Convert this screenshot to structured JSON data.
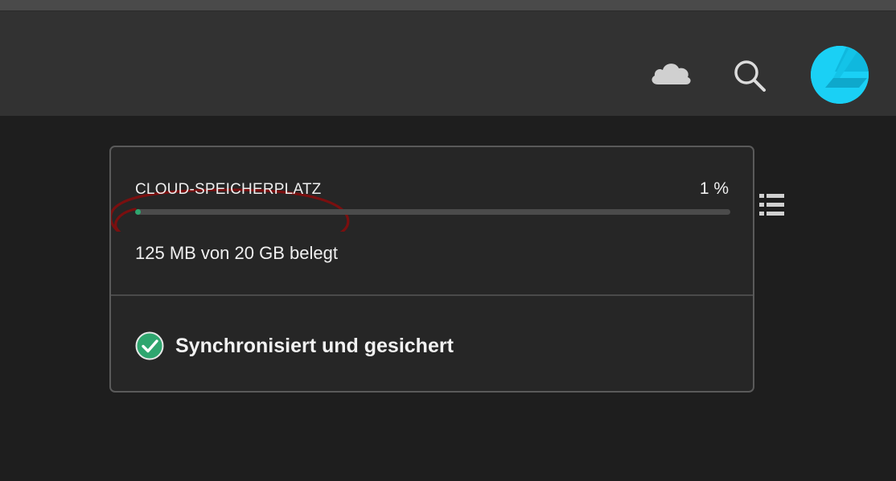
{
  "header": {
    "icons": {
      "cloud": "cloud-icon",
      "search": "search-icon",
      "avatar": "avatar"
    }
  },
  "storage": {
    "label": "CLOUD-SPEICHERPLATZ",
    "percent_text": "1 %",
    "used_fraction": 0.01,
    "usage_text": "125 MB von 20 GB belegt"
  },
  "sync": {
    "status_text": "Synchronisiert und gesichert",
    "icon": "checkmark-circle-icon"
  },
  "side": {
    "icon": "list-view-icon"
  },
  "colors": {
    "accent_green": "#2fa66f",
    "avatar_cyan": "#1ad0f5",
    "annotation_red": "#7a0f0f"
  }
}
